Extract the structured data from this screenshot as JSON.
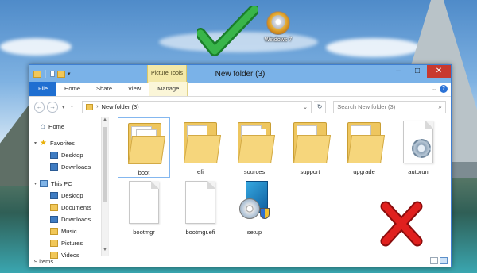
{
  "desktop": {
    "shortcut_label": "Windows 7",
    "shortcut_icon": "dvd-iso-icon"
  },
  "window": {
    "title": "New folder (3)",
    "context_tab_group": "Picture Tools",
    "ribbon_tabs": [
      "File",
      "Home",
      "Share",
      "View",
      "Manage"
    ],
    "address_path": "New folder (3)",
    "search_placeholder": "Search New folder (3)",
    "colors": {
      "file_tab": "#1f6fd1",
      "close_button": "#c8392f",
      "titlebar": "#7ab2e8",
      "context_tab": "#f3e8a8"
    }
  },
  "nav_pane": {
    "items": [
      {
        "label": "Home",
        "icon": "home-icon"
      },
      {
        "label": "Favorites",
        "icon": "star-icon"
      },
      {
        "label": "Desktop",
        "icon": "desktop-icon"
      },
      {
        "label": "Downloads",
        "icon": "downloads-icon"
      },
      {
        "label": "This PC",
        "icon": "computer-icon"
      },
      {
        "label": "Desktop",
        "icon": "desktop-icon"
      },
      {
        "label": "Documents",
        "icon": "documents-icon"
      },
      {
        "label": "Downloads",
        "icon": "downloads-icon"
      },
      {
        "label": "Music",
        "icon": "music-icon"
      },
      {
        "label": "Pictures",
        "icon": "pictures-icon"
      },
      {
        "label": "Videos",
        "icon": "videos-icon"
      }
    ]
  },
  "files": [
    {
      "name": "boot",
      "type": "folder",
      "selected": true
    },
    {
      "name": "efi",
      "type": "folder"
    },
    {
      "name": "sources",
      "type": "folder"
    },
    {
      "name": "support",
      "type": "folder"
    },
    {
      "name": "upgrade",
      "type": "folder"
    },
    {
      "name": "autorun",
      "type": "settings-file"
    },
    {
      "name": "bootmgr",
      "type": "file"
    },
    {
      "name": "bootmgr.efi",
      "type": "file"
    },
    {
      "name": "setup",
      "type": "application"
    }
  ],
  "status": {
    "item_count": "9 items"
  }
}
